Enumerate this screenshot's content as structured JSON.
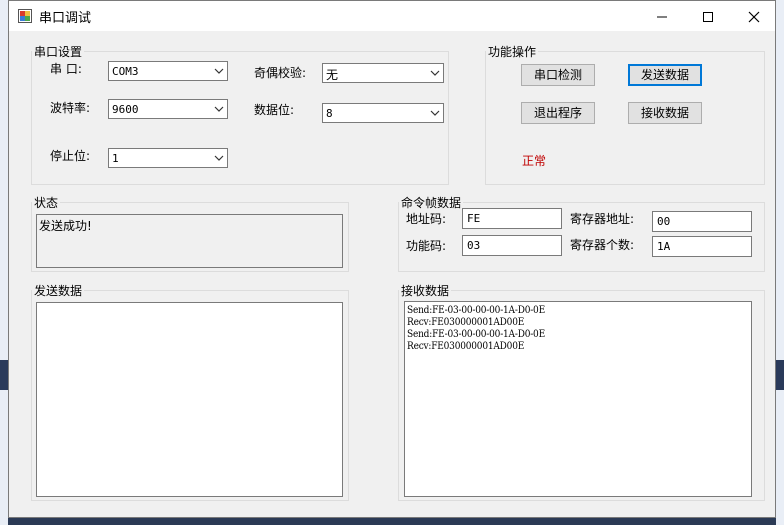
{
  "window": {
    "title": "串口调试",
    "minimize": "—",
    "maximize": "☐",
    "close": "✕"
  },
  "serial_settings": {
    "legend": "串口设置",
    "port_label": "串  口:",
    "port_value": "COM3",
    "baud_label": "波特率:",
    "baud_value": "9600",
    "stop_label": "停止位:",
    "stop_value": "1",
    "parity_label": "奇偶校验:",
    "parity_value": "无",
    "databits_label": "数据位:",
    "databits_value": "8"
  },
  "functions": {
    "legend": "功能操作",
    "detect_port": "串口检测",
    "send_data": "发送数据",
    "exit": "退出程序",
    "receive_data": "接收数据",
    "status_text": "正常"
  },
  "status": {
    "legend": "状态",
    "text": "发送成功!"
  },
  "command_frame": {
    "legend": "命令帧数据",
    "address_label": "地址码:",
    "address_value": "FE",
    "function_label": "功能码:",
    "function_value": "03",
    "reg_addr_label": "寄存器地址:",
    "reg_addr_value": "00",
    "reg_count_label": "寄存器个数:",
    "reg_count_value": "1A"
  },
  "send": {
    "legend": "发送数据",
    "content": ""
  },
  "receive": {
    "legend": "接收数据",
    "lines": [
      "Send:FE-03-00-00-00-1A-D0-0E",
      "Recv:FE030000001AD00E",
      "Send:FE-03-00-00-00-1A-D0-0E",
      "Recv:FE030000001AD00E"
    ]
  },
  "colors": {
    "status_normal": "#c00000",
    "focus_border": "#0078d7"
  }
}
